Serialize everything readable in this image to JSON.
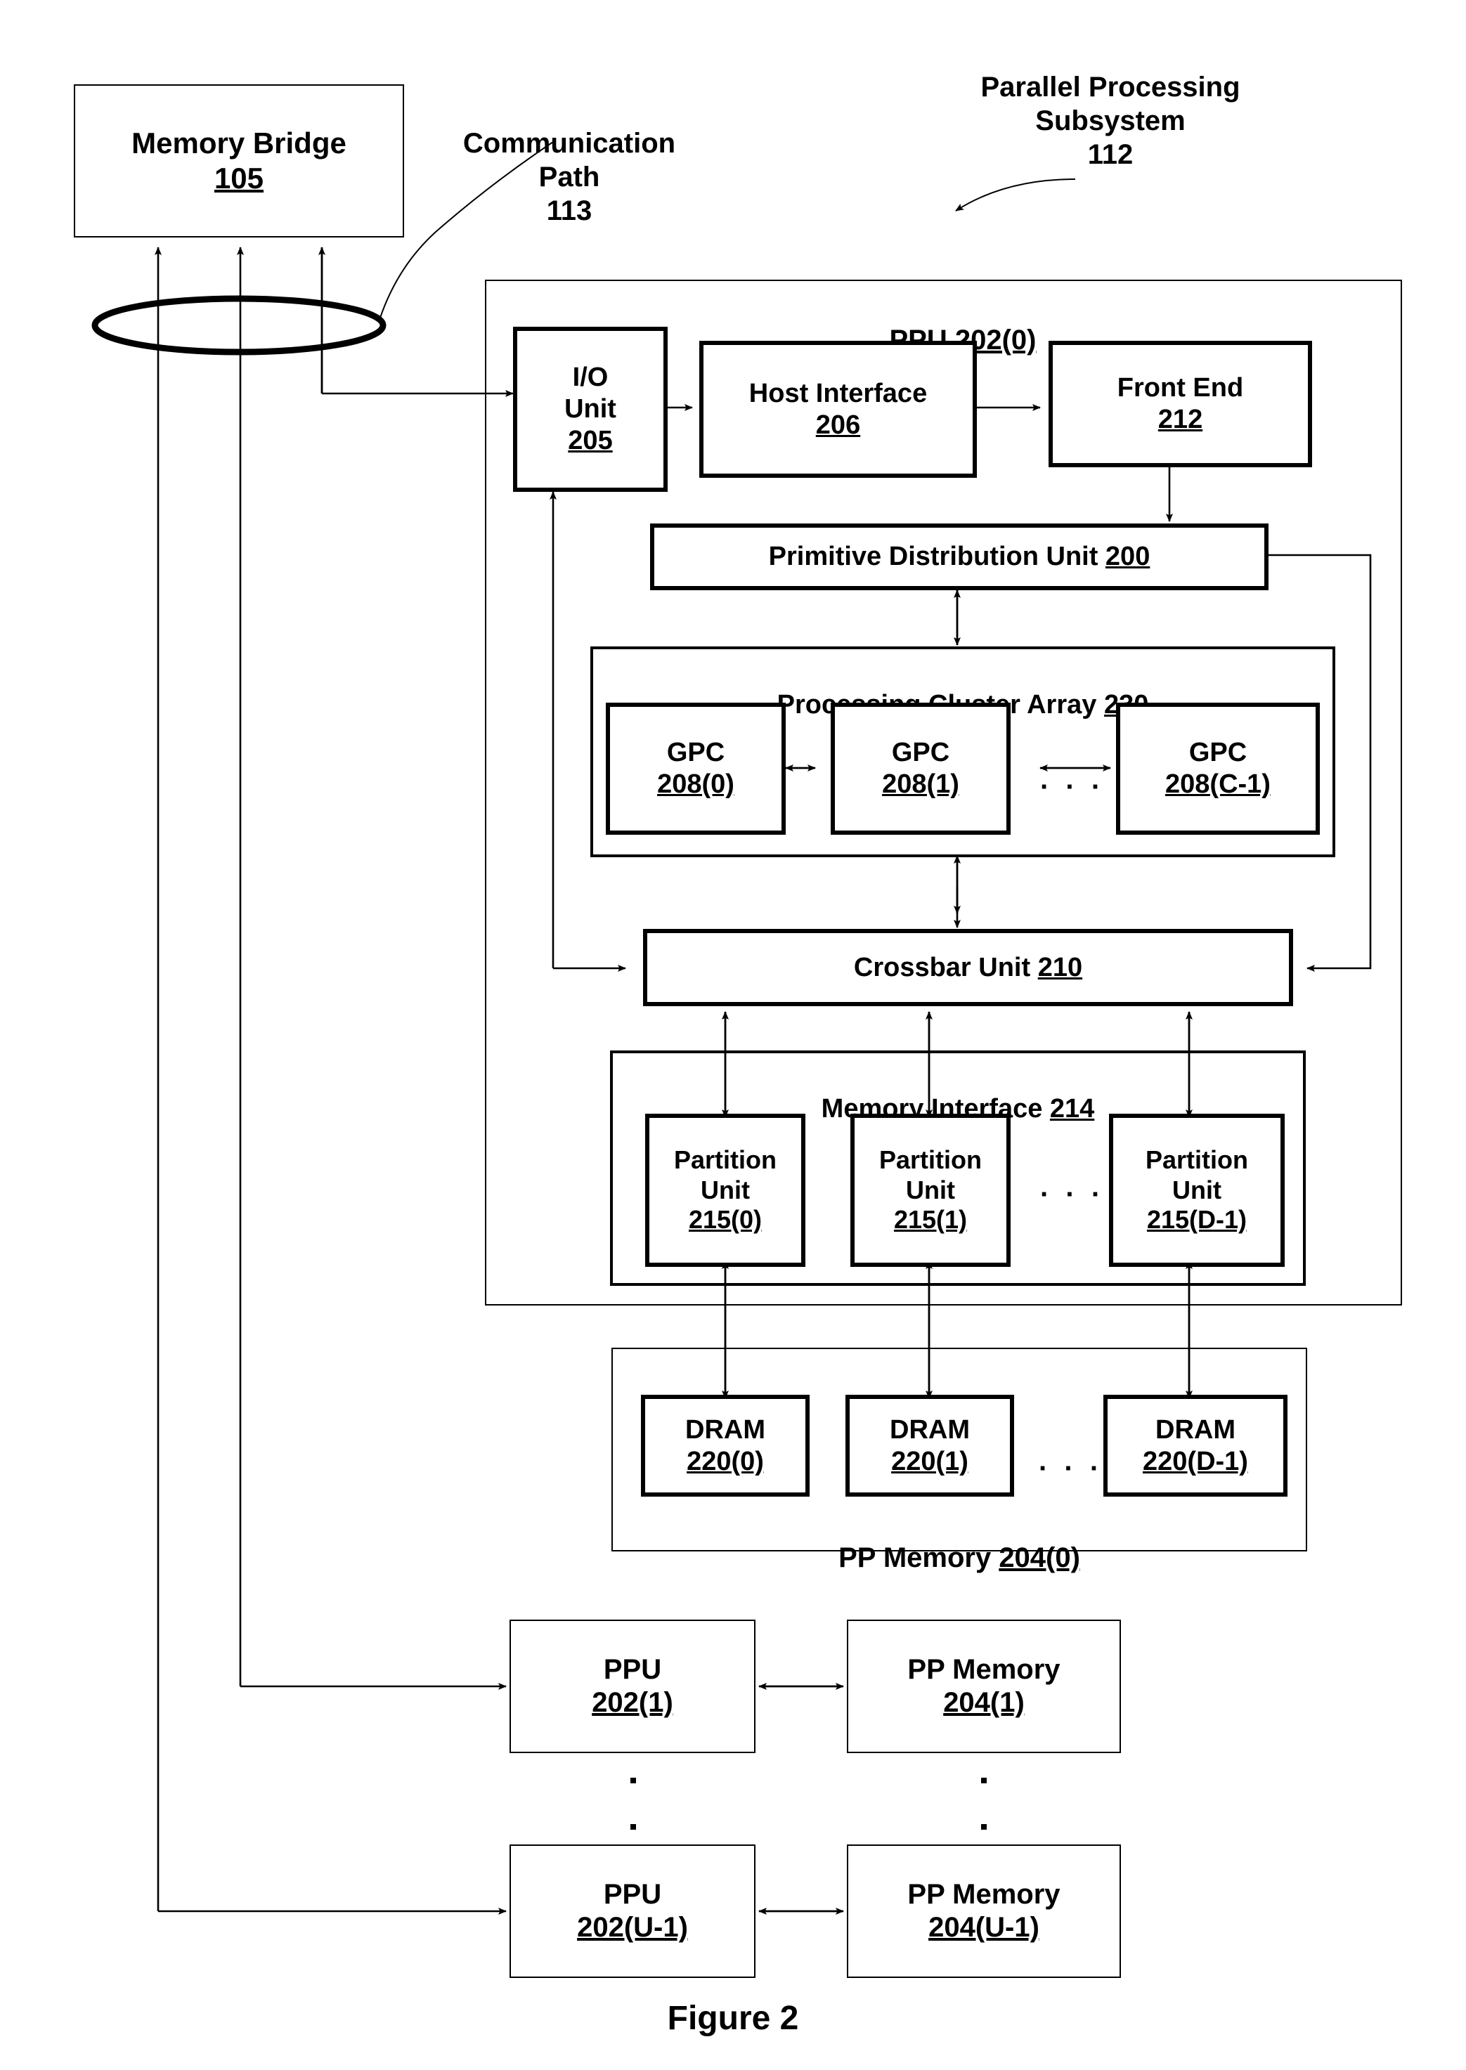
{
  "figure": {
    "caption": "Figure 2"
  },
  "annotations": {
    "parallel_processing_subsystem": "Parallel Processing\nSubsystem\n112",
    "communication_path": "Communication\nPath\n113"
  },
  "memory_bridge": {
    "title": "Memory Bridge",
    "number": "105"
  },
  "ppu0": {
    "header_title": "PPU ",
    "header_number": "202(0)",
    "io_unit": {
      "line1": "I/O",
      "line2": "Unit",
      "number": "205"
    },
    "host_interface": {
      "title": "Host Interface",
      "number": "206"
    },
    "front_end": {
      "title": "Front End",
      "number": "212"
    },
    "primitive_distribution_unit": {
      "title": "Primitive Distribution Unit ",
      "number": "200"
    },
    "processing_cluster_array": {
      "title": "Processing Cluster Array ",
      "number": "230",
      "gpcs": [
        {
          "title": "GPC",
          "number": "208(0)"
        },
        {
          "title": "GPC",
          "number": "208(1)"
        },
        {
          "title": "GPC",
          "number": "208(C-1)"
        }
      ],
      "ellipsis": "· · ·"
    },
    "crossbar_unit": {
      "title": "Crossbar Unit ",
      "number": "210"
    },
    "memory_interface": {
      "title": "Memory Interface ",
      "number": "214",
      "partition_units": [
        {
          "line1": "Partition",
          "line2": "Unit",
          "number": "215(0)"
        },
        {
          "line1": "Partition",
          "line2": "Unit",
          "number": "215(1)"
        },
        {
          "line1": "Partition",
          "line2": "Unit",
          "number": "215(D-1)"
        }
      ],
      "ellipsis": "· · ·"
    }
  },
  "pp_memory0": {
    "title": "PP Memory ",
    "number": "204(0)",
    "drams": [
      {
        "title": "DRAM",
        "number": "220(0)"
      },
      {
        "title": "DRAM",
        "number": "220(1)"
      },
      {
        "title": "DRAM",
        "number": "220(D-1)"
      }
    ],
    "ellipsis": "· · ·"
  },
  "other_ppus": [
    {
      "ppu": {
        "title": "PPU",
        "number": "202(1)"
      },
      "memory": {
        "title": "PP Memory",
        "number": "204(1)"
      }
    },
    {
      "ppu": {
        "title": "PPU",
        "number": "202(U-1)"
      },
      "memory": {
        "title": "PP Memory",
        "number": "204(U-1)"
      }
    }
  ],
  "colors": {
    "stroke": "#000000",
    "background": "#ffffff"
  }
}
